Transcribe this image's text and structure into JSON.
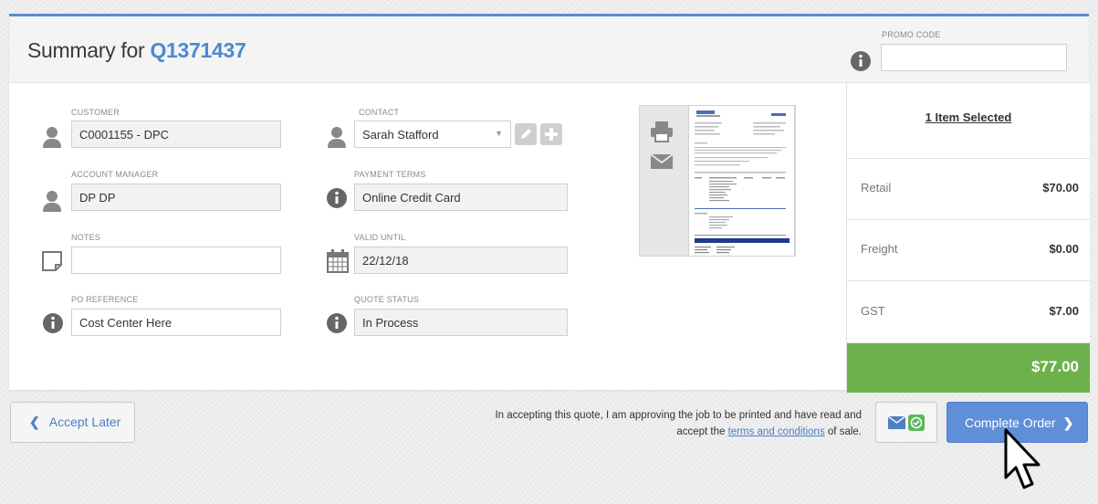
{
  "header": {
    "title_prefix": "Summary for",
    "quote_number": "Q1371437",
    "promo_label": "PROMO CODE",
    "promo_value": ""
  },
  "fields": {
    "customer": {
      "label": "CUSTOMER",
      "value": "C0001155 - DPC"
    },
    "contact": {
      "label": "CONTACT",
      "value": "Sarah Stafford"
    },
    "account_manager": {
      "label": "ACCOUNT MANAGER",
      "value": "DP DP"
    },
    "payment_terms": {
      "label": "PAYMENT TERMS",
      "value": "Online Credit Card"
    },
    "notes": {
      "label": "NOTES",
      "value": ""
    },
    "valid_until": {
      "label": "VALID UNTIL",
      "value": "22/12/18"
    },
    "po_reference": {
      "label": "PO REFERENCE",
      "value": "Cost Center Here"
    },
    "quote_status": {
      "label": "QUOTE STATUS",
      "value": "In Process"
    }
  },
  "summary": {
    "items_selected": "1 Item Selected",
    "retail_label": "Retail",
    "retail_value": "$70.00",
    "freight_label": "Freight",
    "freight_value": "$0.00",
    "gst_label": "GST",
    "gst_value": "$7.00",
    "total_value": "$77.00"
  },
  "footer": {
    "accept_later": "Accept Later",
    "terms_line1": "In accepting this quote, I am approving the job to be printed and have read and",
    "terms_pre": "accept the ",
    "terms_link": "terms and conditions",
    "terms_post": " of sale.",
    "complete_order": "Complete Order"
  },
  "colors": {
    "accent": "#5b8ad1",
    "total_green": "#6cb14b",
    "check_green": "#5cb85c"
  },
  "icons": [
    "person-icon",
    "info-icon",
    "note-icon",
    "calendar-icon",
    "pencil-icon",
    "plus-icon",
    "print-icon",
    "envelope-icon",
    "check-icon",
    "chevron-left-icon",
    "chevron-right-icon",
    "cursor-icon"
  ]
}
